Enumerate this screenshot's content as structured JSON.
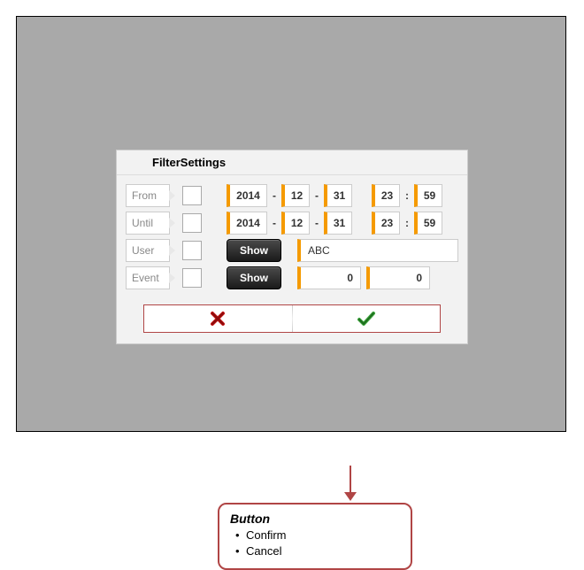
{
  "dialog": {
    "title": "FilterSettings",
    "rows": {
      "from": {
        "label": "From",
        "year": "2014",
        "month": "12",
        "day": "31",
        "hour": "23",
        "minute": "59"
      },
      "until": {
        "label": "Until",
        "year": "2014",
        "month": "12",
        "day": "31",
        "hour": "23",
        "minute": "59"
      },
      "user": {
        "label": "User",
        "button": "Show",
        "value": "ABC"
      },
      "event": {
        "label": "Event",
        "button": "Show",
        "value1": "0",
        "value2": "0"
      }
    }
  },
  "callout": {
    "title": "Button",
    "items": [
      "Confirm",
      "Cancel"
    ]
  }
}
